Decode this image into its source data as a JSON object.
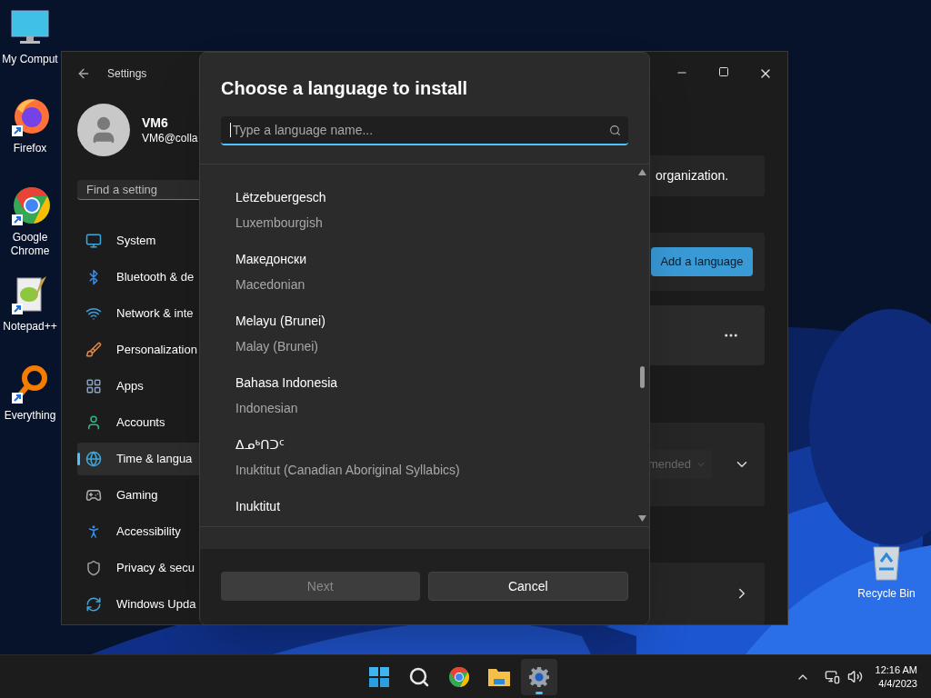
{
  "desktop_icons": [
    {
      "label": "My Comput",
      "kind": "monitor"
    },
    {
      "label": "Firefox",
      "kind": "firefox"
    },
    {
      "label": "Google Chrome",
      "kind": "chrome"
    },
    {
      "label": "Notepad++",
      "kind": "notepad"
    },
    {
      "label": "Everything",
      "kind": "magnifier"
    }
  ],
  "recycle_bin": {
    "label": "Recycle Bin"
  },
  "settings_window": {
    "title": "Settings",
    "account": {
      "name": "VM6",
      "email": "VM6@colla"
    },
    "search": {
      "placeholder": "Find a setting"
    },
    "nav": [
      {
        "label": "System",
        "kind": "system",
        "selected": false
      },
      {
        "label": "Bluetooth & de",
        "kind": "bluetooth",
        "selected": false
      },
      {
        "label": "Network & inte",
        "kind": "network",
        "selected": false
      },
      {
        "label": "Personalization",
        "kind": "personalization",
        "selected": false
      },
      {
        "label": "Apps",
        "kind": "apps",
        "selected": false
      },
      {
        "label": "Accounts",
        "kind": "accounts",
        "selected": false
      },
      {
        "label": "Time & langua",
        "kind": "time",
        "selected": true
      },
      {
        "label": "Gaming",
        "kind": "gaming",
        "selected": false
      },
      {
        "label": "Accessibility",
        "kind": "accessibility",
        "selected": false
      },
      {
        "label": "Privacy & secu",
        "kind": "privacy",
        "selected": false
      },
      {
        "label": "Windows Upda",
        "kind": "update",
        "selected": false
      }
    ],
    "content": {
      "notice": "organization.",
      "add_button": "Add a language",
      "dropdown": {
        "value": "mended",
        "disabled": true
      }
    }
  },
  "dialog": {
    "title": "Choose a language to install",
    "search": {
      "placeholder": "Type a language name..."
    },
    "languages": [
      {
        "native": "Lëtzebuergesch",
        "english": "Luxembourgish"
      },
      {
        "native": "Македонски",
        "english": "Macedonian"
      },
      {
        "native": "Melayu (Brunei)",
        "english": "Malay (Brunei)"
      },
      {
        "native": "Bahasa Indonesia",
        "english": "Indonesian"
      },
      {
        "native": "ᐃᓄᒃᑎᑐᑦ",
        "english": "Inuktitut (Canadian Aboriginal Syllabics)"
      },
      {
        "native": "Inuktitut"
      }
    ],
    "buttons": [
      {
        "label": "Next",
        "disabled": true
      },
      {
        "label": "Cancel",
        "disabled": false
      }
    ]
  },
  "taskbar": {
    "apps": [
      {
        "kind": "start",
        "active": false
      },
      {
        "kind": "search",
        "active": false
      },
      {
        "kind": "chrome",
        "active": false
      },
      {
        "kind": "folder",
        "active": false
      },
      {
        "kind": "settings",
        "active": true
      }
    ],
    "clock": {
      "time": "12:16 AM",
      "date": "4/4/2023"
    }
  }
}
